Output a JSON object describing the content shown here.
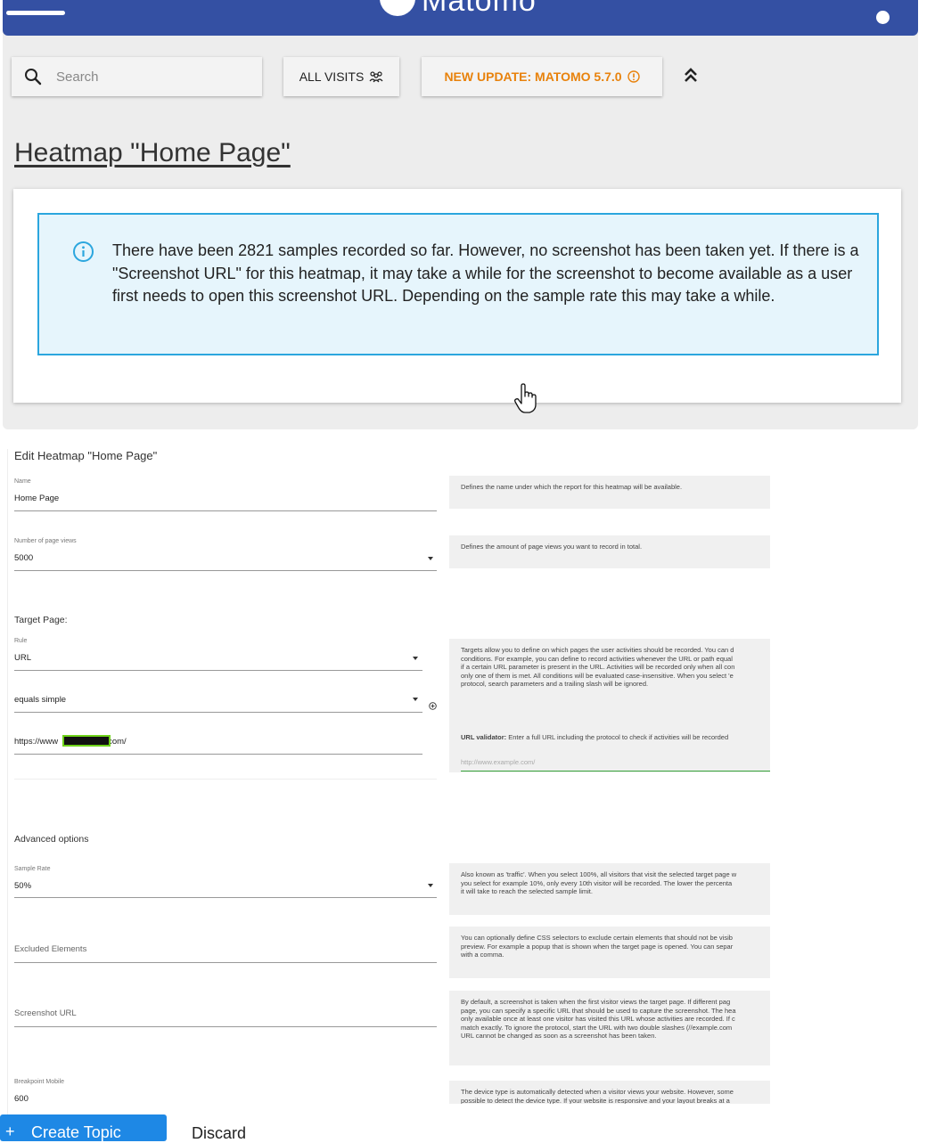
{
  "topbar": {
    "logo_text": "Matomo"
  },
  "toolbar": {
    "search_placeholder": "Search",
    "all_visits_label": "ALL VISITS",
    "update_label": "NEW UPDATE: MATOMO 5.7.0"
  },
  "page": {
    "title": "Heatmap \"Home Page\"",
    "notice": "There have been 2821 samples recorded so far. However, no screenshot has been taken yet. If there is a \"Screenshot URL\" for this heatmap, it may take a while for the screenshot to become available as a user first needs to open this screenshot URL. Depending on the sample rate this may take a while."
  },
  "form": {
    "title": "Edit Heatmap \"Home Page\"",
    "name_label": "Name",
    "name_value": "Home Page",
    "name_help": "Defines the name under which the report for this heatmap will be available.",
    "pageviews_label": "Number of page views",
    "pageviews_value": "5000",
    "pageviews_help": "Defines the amount of page views you want to record in total.",
    "target_section": "Target Page:",
    "rule_label": "Rule",
    "rule_value": "URL",
    "match_value": "equals simple",
    "url_prefix": "https://www",
    "url_suffix": "com/",
    "target_help": [
      "Targets allow you to define on which pages the user activities should be recorded. You can d",
      "conditions. For example, you can define to record activities whenever the URL or path equal",
      "if a certain URL parameter is present in the URL. Activities will be recorded only when all con",
      "only one of them is met. All conditions will be evaluated case-insensitive. When you select 'e",
      "protocol, search parameters and a trailing slash will be ignored."
    ],
    "url_validator_label": "URL validator:",
    "url_validator_text": "Enter a full URL including the protocol to check if activities will be recorded",
    "url_validator_placeholder": "http://www.example.com/",
    "advanced_section": "Advanced options",
    "sample_rate_label": "Sample Rate",
    "sample_rate_value": "50%",
    "sample_rate_help": [
      "Also known as 'traffic'. When you select 100%, all visitors that visit the selected target page w",
      "you select for example 10%, only every 10th visitor will be recorded. The lower the percenta",
      "it will take to reach the selected sample limit."
    ],
    "excluded_placeholder": "Excluded Elements",
    "excluded_help": [
      "You can optionally define CSS selectors to exclude certain elements that should not be visib",
      "preview. For example a popup that is shown when the target page is opened. You can separ",
      "with a comma."
    ],
    "screenshot_placeholder": "Screenshot URL",
    "screenshot_help": [
      "By default, a screenshot is taken when the first visitor views the target page. If different pag",
      "page, you can specify a specific URL that should be used to capture the screenshot. The hea",
      "only available once at least one visitor has visited this URL whose activities are recorded. If c",
      "match exactly. To ignore the protocol, start the URL with two double slashes (//example.com",
      "URL cannot be changed as soon as a screenshot has been taken."
    ],
    "breakpoint_label": "Breakpoint Mobile",
    "breakpoint_value": "600",
    "breakpoint_help": [
      "The device type is automatically detected when a visitor views your website. However, some",
      "possible to detect the device type. If your website is responsive and your layout breaks at a"
    ]
  },
  "footer": {
    "create_label": "Create Topic",
    "discard_label": "Discard"
  },
  "colors": {
    "topbar": "#3450a3",
    "update_orange": "#e8820c",
    "notice_border": "#2ba6de",
    "notice_bg": "#e6f5fc",
    "primary_button": "#1e88e5"
  }
}
